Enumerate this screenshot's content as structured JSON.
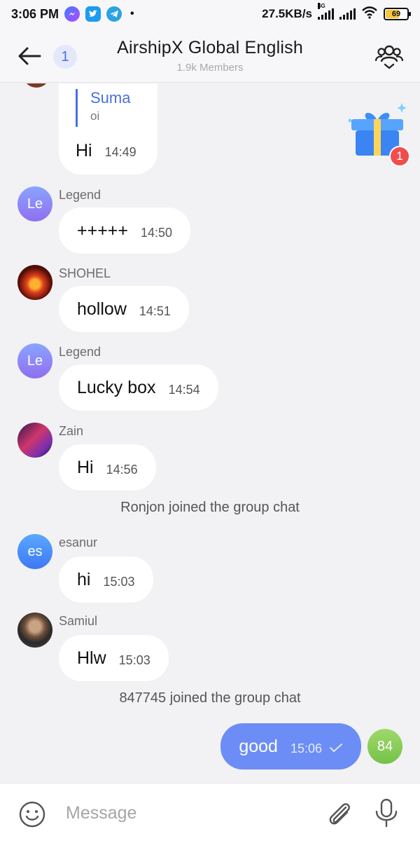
{
  "status_bar": {
    "time": "3:06 PM",
    "dot": "•",
    "speed": "27.5KB/s",
    "network_tag": "4G",
    "battery": "69",
    "battery_color": "#f5c63b",
    "notification_icons": [
      "messenger-icon",
      "twitter-icon",
      "telegram-icon"
    ]
  },
  "header": {
    "unread_count": "1",
    "title": "AirshipX Global English",
    "subtitle": "1.9k Members"
  },
  "colors": {
    "accent": "#4a6fe3",
    "outgoing_bubble": "#6c8df5",
    "badge": "#f04e4e"
  },
  "gift": {
    "badge_count": "1"
  },
  "messages": [
    {
      "reply_to_name": "Suma",
      "reply_to_text": "oi",
      "text": "Hi",
      "time": "14:49"
    },
    {
      "avatar_text": "Le",
      "sender": "Legend",
      "text": "+++++",
      "time": "14:50"
    },
    {
      "sender": "SHOHEL",
      "text": "hollow",
      "time": "14:51"
    },
    {
      "avatar_text": "Le",
      "sender": "Legend",
      "text": "Lucky box",
      "time": "14:54"
    },
    {
      "sender": "Zain",
      "text": "Hi",
      "time": "14:56"
    },
    {
      "system": "Ronjon joined the group chat"
    },
    {
      "avatar_text": "es",
      "sender": "esanur",
      "text": "hi",
      "time": "15:03"
    },
    {
      "sender": "Samiul",
      "text": "Hlw",
      "time": "15:03"
    },
    {
      "system": "847745 joined the group chat"
    },
    {
      "outgoing": true,
      "avatar_text": "84",
      "text": "good",
      "time": "15:06"
    }
  ],
  "composer": {
    "placeholder": "Message"
  }
}
